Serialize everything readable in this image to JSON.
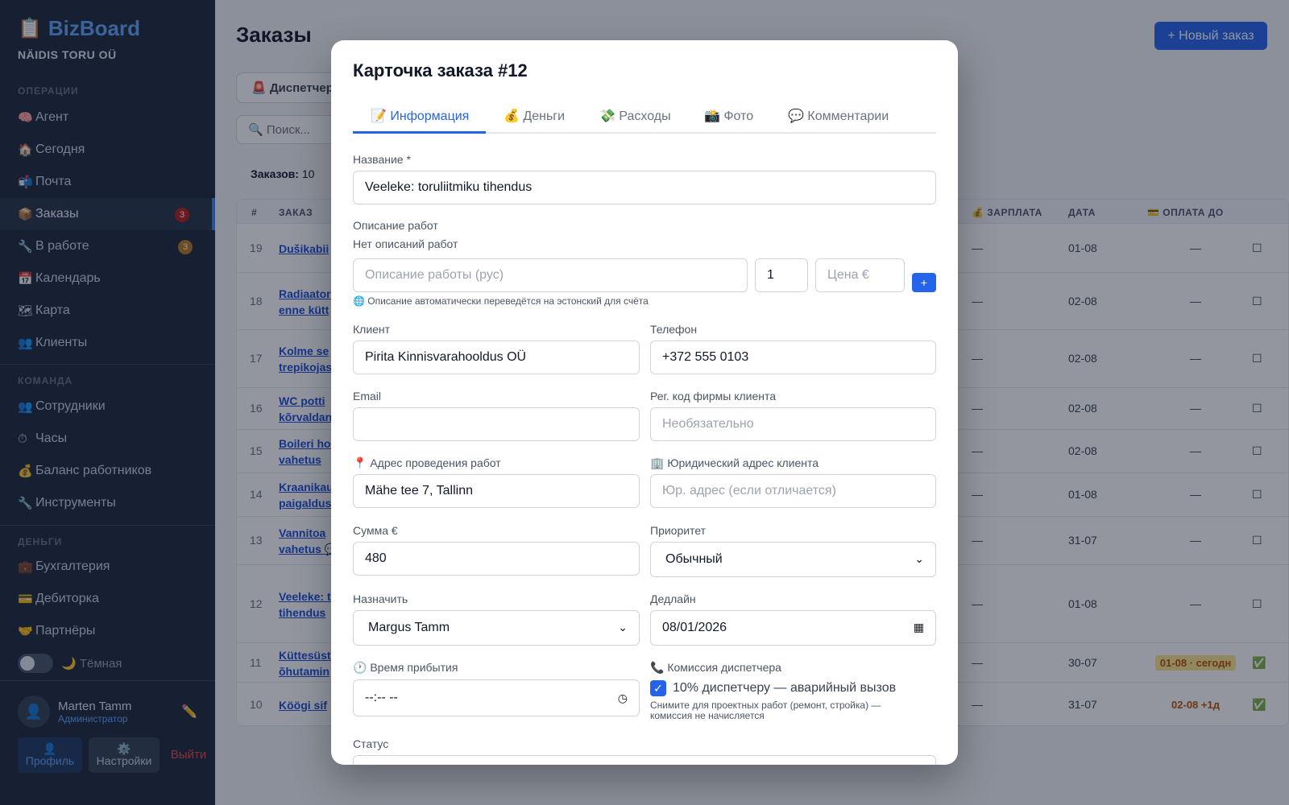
{
  "sidebar": {
    "brand_icon": "📋",
    "brand_name": "BizBoard",
    "company": "NÄIDIS TORU OÜ",
    "sections": {
      "operations": "ОПЕРАЦИИ",
      "team": "КОМАНДА",
      "money": "ДЕНЬГИ"
    },
    "items": [
      {
        "icon": "🧠",
        "label": "Агент"
      },
      {
        "icon": "🏠",
        "label": "Сегодня"
      },
      {
        "icon": "📬",
        "label": "Почта"
      },
      {
        "icon": "📦",
        "label": "Заказы",
        "badge": "3"
      },
      {
        "icon": "🔧",
        "label": "В работе",
        "badge": "3"
      },
      {
        "icon": "📅",
        "label": "Календарь"
      },
      {
        "icon": "🗺",
        "label": "Карта"
      },
      {
        "icon": "👥",
        "label": "Клиенты"
      },
      {
        "icon": "👥",
        "label": "Сотрудники"
      },
      {
        "icon": "⏱",
        "label": "Часы"
      },
      {
        "icon": "💰",
        "label": "Баланс работников"
      },
      {
        "icon": "🔧",
        "label": "Инструменты"
      },
      {
        "icon": "💼",
        "label": "Бухгалтерия"
      },
      {
        "icon": "💳",
        "label": "Дебиторка"
      },
      {
        "icon": "🤝",
        "label": "Партнёры"
      }
    ],
    "dark_toggle": "🌙 Тёмная",
    "user": {
      "avatar": "👤",
      "name": "Marten Tamm",
      "role": "Администратор",
      "edit_icon": "✏️"
    },
    "profile_btn": {
      "icon": "👤",
      "label": "Профиль"
    },
    "settings_btn": {
      "icon": "⚙️",
      "label": "Настройки"
    },
    "logout": "Выйти"
  },
  "main": {
    "title": "Заказы",
    "new_order": "+ Новый заказ",
    "dispatch_chip": "🚨 Диспетчер",
    "search_placeholder": "🔍 Поиск...",
    "count_label": "Заказов:",
    "count_value": "10",
    "columns": {
      "num": "#",
      "order": "ЗАКАЗ",
      "salary": "💰 ЗАРПЛАТА",
      "date": "ДАТА",
      "pay_until": "💳 ОПЛАТА ДО"
    },
    "rows": [
      {
        "num": "19",
        "title": "Dušikabii",
        "salary": "—",
        "date": "01-08",
        "pay": "—",
        "check": "☐"
      },
      {
        "num": "18",
        "title": "Radiaator enne kütt",
        "salary": "—",
        "date": "02-08",
        "pay": "—",
        "check": "☐"
      },
      {
        "num": "17",
        "title": "Kolme se trepikojas",
        "salary": "—",
        "date": "02-08",
        "pay": "—",
        "check": "☐"
      },
      {
        "num": "16",
        "title": "WC potti kõrvaldan",
        "salary": "—",
        "date": "02-08",
        "pay": "—",
        "check": "☐"
      },
      {
        "num": "15",
        "title": "Boileri ho vahetus",
        "salary": "—",
        "date": "02-08",
        "pay": "—",
        "check": "☐"
      },
      {
        "num": "14",
        "title": "Kraanikau paigaldus",
        "salary": "—",
        "date": "01-08",
        "pay": "—",
        "check": "☐"
      },
      {
        "num": "13",
        "title": "Vannitoa vahetus 💬",
        "salary": "—",
        "date": "31-07",
        "pay": "—",
        "check": "☐"
      },
      {
        "num": "12",
        "title": "Veeleke: t tihendus",
        "salary": "—",
        "date": "01-08",
        "pay": "—",
        "check": "☐"
      },
      {
        "num": "11",
        "title": "Küttesüst õhutamin",
        "salary": "—",
        "date": "30-07",
        "pay": "01-08 · сегодн",
        "check": "✅"
      },
      {
        "num": "10",
        "title": "Köögi sif",
        "salary": "—",
        "date": "31-07",
        "pay": "02-08 +1д",
        "check": "✅"
      }
    ]
  },
  "modal": {
    "title": "Карточка заказа #12",
    "tabs": [
      "📝 Информация",
      "💰 Деньги",
      "💸 Расходы",
      "📸 Фото",
      "💬 Комментарии"
    ],
    "name_label": "Название *",
    "name_value": "Veeleke: toruliitmiku tihendus",
    "works_label": "Описание работ",
    "works_empty": "Нет описаний работ",
    "work_desc_placeholder": "Описание работы (рус)",
    "work_qty": "1",
    "work_price_placeholder": "Цена €",
    "add_work": "+",
    "translate_hint": "🌐 Описание автоматически переведётся на эстонский для счёта",
    "client_label": "Клиент",
    "client_value": "Pirita Kinnisvarahooldus OÜ",
    "phone_label": "Телефон",
    "phone_value": "+372 555 0103",
    "email_label": "Email",
    "email_value": "",
    "regcode_label": "Рег. код фирмы клиента",
    "regcode_placeholder": "Необязательно",
    "address_label": "📍 Адрес проведения работ",
    "address_value": "Mähe tee 7, Tallinn",
    "legal_label": "🏢 Юридический адрес клиента",
    "legal_placeholder": "Юр. адрес (если отличается)",
    "sum_label": "Сумма €",
    "sum_value": "480",
    "priority_label": "Приоритет",
    "priority_value": "Обычный",
    "assign_label": "Назначить",
    "assign_value": "Margus Tamm",
    "deadline_label": "Дедлайн",
    "deadline_value": "08/01/2026",
    "arrival_label": "🕐 Время прибытия",
    "arrival_value": "--:-- --",
    "commission_label": "📞 Комиссия диспетчера",
    "commission_checked": true,
    "commission_text": "10% диспетчеру — аварийный вызов",
    "commission_note": "Снимите для проектных работ (ремонт, стройка) — комиссия не начисляется",
    "status_label": "Статус"
  },
  "colors": {
    "accent": "#2563eb",
    "sidebar_bg": "#1e293b",
    "badge_red": "#b91c1c",
    "badge_amber": "#b7791f"
  }
}
